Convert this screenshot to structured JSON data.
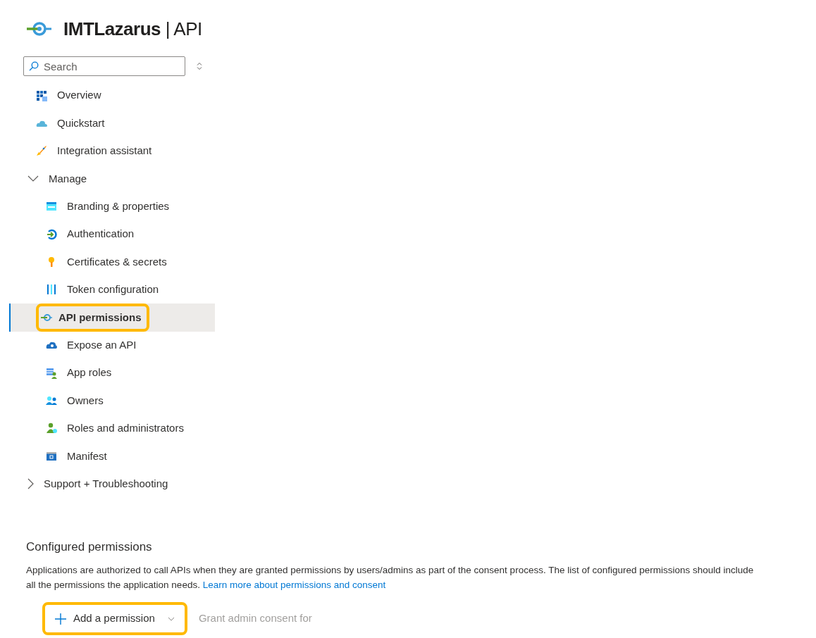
{
  "header": {
    "title": "IMTLazarus",
    "subtitle": "| API"
  },
  "search": {
    "placeholder": "Search"
  },
  "nav": [
    {
      "kind": "link",
      "label": "Overview",
      "selected": false
    },
    {
      "kind": "link",
      "label": "Quickstart",
      "selected": false
    },
    {
      "kind": "link",
      "label": "Integration assistant",
      "selected": false
    },
    {
      "kind": "group",
      "label": "Manage",
      "expanded": true,
      "children": [
        {
          "label": "Branding & properties",
          "selected": false,
          "highlighted": false
        },
        {
          "label": "Authentication",
          "selected": false,
          "highlighted": false
        },
        {
          "label": "Certificates & secrets",
          "selected": false,
          "highlighted": false
        },
        {
          "label": "Token configuration",
          "selected": false,
          "highlighted": false
        },
        {
          "label": "API permissions",
          "selected": true,
          "highlighted": true
        },
        {
          "label": "Expose an API",
          "selected": false,
          "highlighted": false
        },
        {
          "label": "App roles",
          "selected": false,
          "highlighted": false
        },
        {
          "label": "Owners",
          "selected": false,
          "highlighted": false
        },
        {
          "label": "Roles and administrators",
          "selected": false,
          "highlighted": false
        },
        {
          "label": "Manifest",
          "selected": false,
          "highlighted": false
        }
      ]
    },
    {
      "kind": "group",
      "label": "Support + Troubleshooting",
      "expanded": false
    }
  ],
  "section": {
    "title": "Configured permissions",
    "description": "Applications are authorized to call APIs when they are granted permissions by users/admins as part of the consent process. The list of configured permissions should include\nall the permissions the application needs. ",
    "link": "Learn more about permissions and consent"
  },
  "toolbar": [
    {
      "kind": "add",
      "label": "Add a permission",
      "disabled": false,
      "highlighted": true
    },
    {
      "kind": "plain",
      "label": "Grant admin consent for",
      "disabled": true,
      "highlighted": false
    }
  ]
}
